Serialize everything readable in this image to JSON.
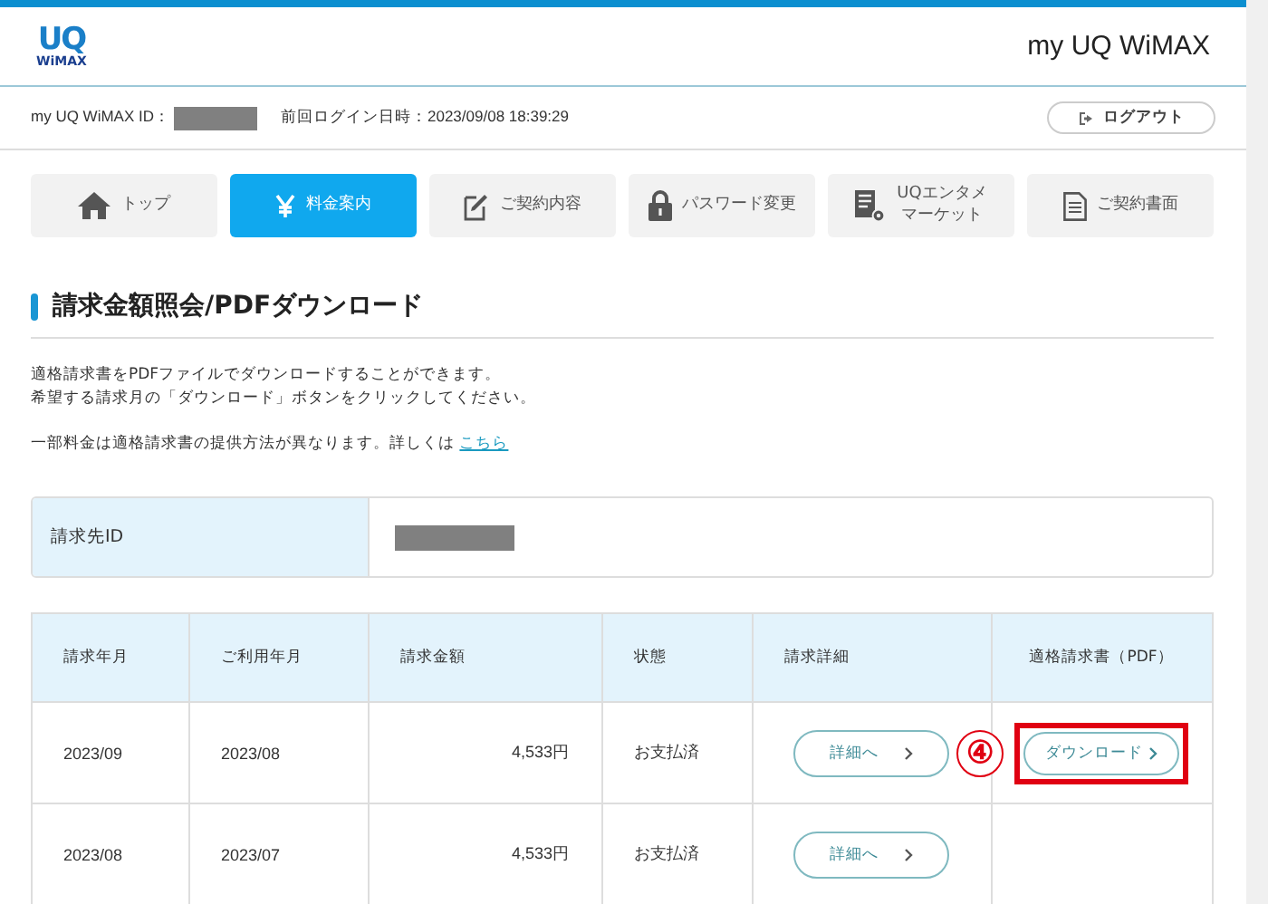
{
  "header": {
    "logo_top": "UQ",
    "logo_bottom": "WiMAX",
    "site_title": "my UQ WiMAX"
  },
  "account_bar": {
    "id_label": "my UQ WiMAX ID：",
    "last_login": "前回ログイン日時：2023/09/08 18:39:29",
    "logout_button": "ログアウト"
  },
  "tabs": [
    {
      "lines": [
        "トップ"
      ],
      "selected": false
    },
    {
      "lines": [
        "料金案内"
      ],
      "selected": true
    },
    {
      "lines": [
        "ご契約内容"
      ],
      "selected": false
    },
    {
      "lines": [
        "パスワード変更"
      ],
      "selected": false
    },
    {
      "lines": [
        "UQエンタメ",
        "マーケット"
      ],
      "selected": false
    },
    {
      "lines": [
        "ご契約書面"
      ],
      "selected": false
    }
  ],
  "heading": "請求金額照会/PDFダウンロード",
  "intro": [
    "適格請求書をPDFファイルでダウンロードすることができます。",
    "希望する請求月の「ダウンロード」ボタンをクリックしてください。"
  ],
  "note": {
    "text": "一部料金は適格請求書の提供方法が異なります。詳しくは ",
    "link": "こちら"
  },
  "billing_id": {
    "label": "請求先ID"
  },
  "table": {
    "columns": [
      "請求年月",
      "ご利用年月",
      "請求金額",
      "状態",
      "請求詳細",
      "適格請求書（PDF）"
    ],
    "rows": [
      {
        "billing_month": "2023/09",
        "usage_month": "2023/08",
        "amount": "4,533円",
        "status": "お支払済",
        "detail_button": "詳細へ",
        "download_button": "ダウンロード",
        "highlighted": true
      },
      {
        "billing_month": "2023/08",
        "usage_month": "2023/07",
        "amount": "4,533円",
        "status": "お支払済",
        "detail_button": "詳細へ",
        "highlighted": false
      }
    ]
  },
  "annotation": {
    "label": "④"
  }
}
